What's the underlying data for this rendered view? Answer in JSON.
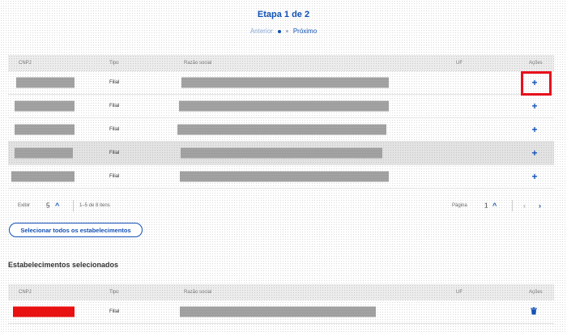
{
  "stepper": {
    "title": "Etapa 1 de 2",
    "prev_label": "Anterior",
    "next_label": "Próximo"
  },
  "table": {
    "headers": [
      "CNPJ",
      "Tipo",
      "Razão social",
      "UF",
      "Ações"
    ],
    "rows": [
      {
        "tipo": "Filial"
      },
      {
        "tipo": "Filial"
      },
      {
        "tipo": "Filial"
      },
      {
        "tipo": "Filial"
      },
      {
        "tipo": "Filial"
      }
    ],
    "add_action_icon": "plus-icon"
  },
  "pagination": {
    "show_label": "Exibir",
    "per_page": "5",
    "range_label": "1–5 de 8 itens",
    "page_label": "Página",
    "current_page": "1"
  },
  "select_all_label": "Selecionar todos os estabelecimentos",
  "selected": {
    "title": "Estabelecimentos selecionados",
    "headers": [
      "CNPJ",
      "Tipo",
      "Razão social",
      "UF",
      "Ações"
    ],
    "rows": [
      {
        "tipo": "Filial"
      }
    ],
    "remove_action_icon": "trash-icon"
  },
  "colors": {
    "primary": "#1351b4",
    "highlight": "#e8101b"
  }
}
